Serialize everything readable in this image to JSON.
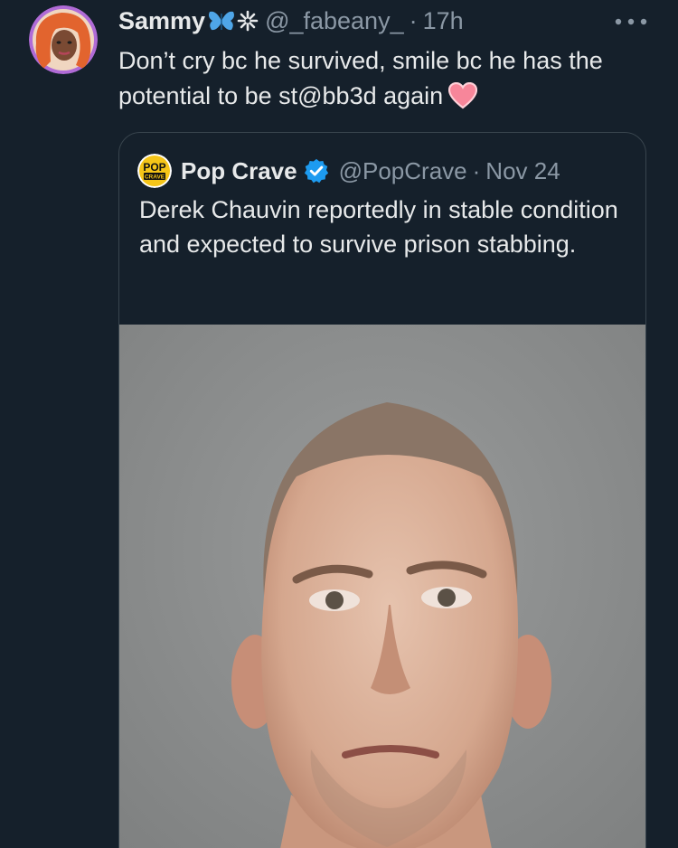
{
  "tweet": {
    "display_name": "Sammy",
    "handle": "@_fabeany_",
    "separator": "·",
    "time": "17h",
    "text": "Don’t cry bc he survived, smile bc he has the potential to be st@bb3d again",
    "icons": [
      "butterfly-icon",
      "sparkle-icon",
      "heart-icon",
      "more-options-icon"
    ]
  },
  "quote": {
    "display_name": "Pop Crave",
    "handle": "@PopCrave",
    "separator": "·",
    "date": "Nov 24",
    "text": "Derek Chauvin reportedly in stable condition and expected to survive prison stabbing.",
    "logo_text_top": "POP",
    "logo_text_bottom": "CRAVE",
    "icons": [
      "verified-badge-icon"
    ]
  },
  "colors": {
    "background": "#15202b",
    "text_primary": "#e7e9ea",
    "text_secondary": "#8b98a5",
    "border": "#38444d",
    "verified": "#1d9bf0",
    "heart": "#f7869a"
  }
}
